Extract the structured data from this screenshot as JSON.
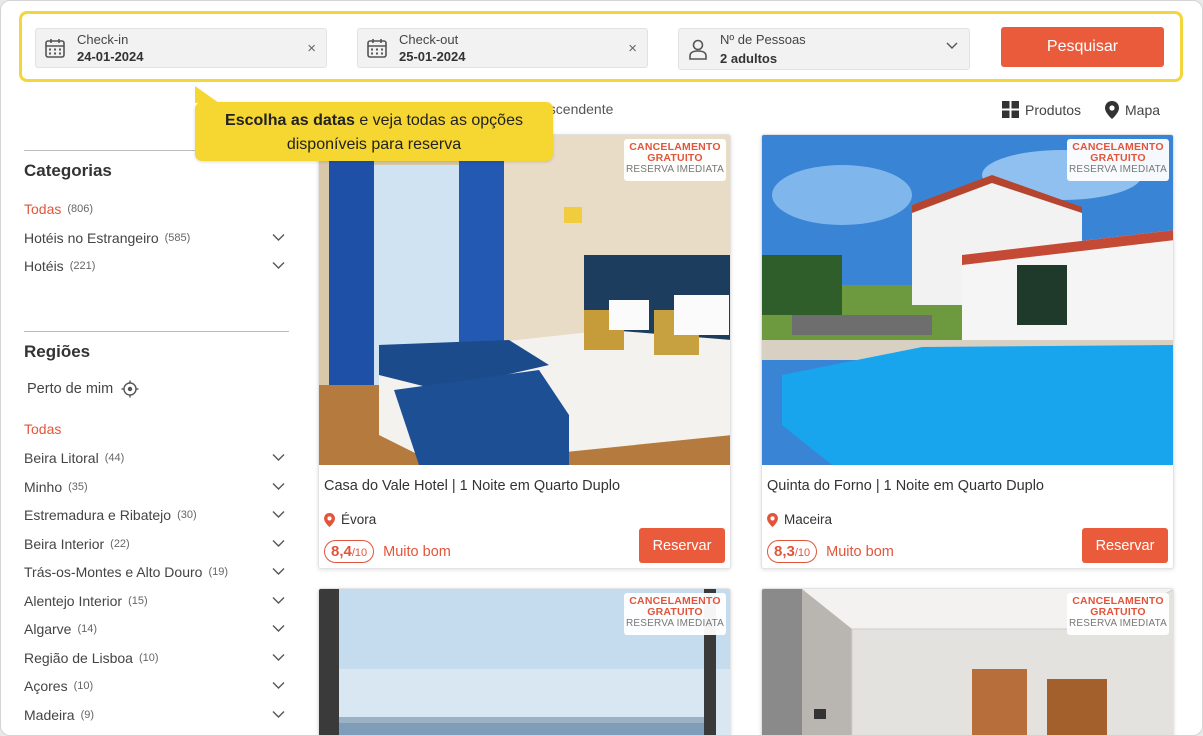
{
  "search": {
    "checkin_label": "Check-in",
    "checkin_value": "24-01-2024",
    "checkout_label": "Check-out",
    "checkout_value": "25-01-2024",
    "people_label": "Nº de Pessoas",
    "people_value": "2 adultos",
    "clear_glyph": "×",
    "search_button": "Pesquisar"
  },
  "tooltip": {
    "bold": "Escolha as datas",
    "text": "e veja todas as opções disponíveis para reserva"
  },
  "toolbar": {
    "sort_partial": "ascendente",
    "products_label": "Produtos",
    "map_label": "Mapa"
  },
  "categories": {
    "title": "Categorias",
    "items": [
      {
        "label": "Todas",
        "count": "(806)"
      },
      {
        "label": "Hotéis no Estrangeiro",
        "count": "(585)"
      },
      {
        "label": "Hotéis",
        "count": "(221)"
      }
    ]
  },
  "regions": {
    "title": "Regiões",
    "near_me": "Perto de mim",
    "all": "Todas",
    "items": [
      {
        "label": "Beira Litoral",
        "count": "(44)"
      },
      {
        "label": "Minho",
        "count": "(35)"
      },
      {
        "label": "Estremadura e Ribatejo",
        "count": "(30)"
      },
      {
        "label": "Beira Interior",
        "count": "(22)"
      },
      {
        "label": "Trás-os-Montes e Alto Douro",
        "count": "(19)"
      },
      {
        "label": "Alentejo Interior",
        "count": "(15)"
      },
      {
        "label": "Algarve",
        "count": "(14)"
      },
      {
        "label": "Região de Lisboa",
        "count": "(10)"
      },
      {
        "label": "Açores",
        "count": "(10)"
      },
      {
        "label": "Madeira",
        "count": "(9)"
      }
    ]
  },
  "badge": {
    "line1": "CANCELAMENTO",
    "line2": "GRATUITO",
    "line3": "RESERVA IMEDIATA"
  },
  "cards": [
    {
      "title": "Casa do Vale Hotel | 1 Noite em Quarto Duplo",
      "location": "Évora",
      "score": "8,4",
      "score_max": "/10",
      "rating_word": "Muito bom",
      "button": "Reservar"
    },
    {
      "title": "Quinta do Forno | 1 Noite em Quarto Duplo",
      "location": "Maceira",
      "score": "8,3",
      "score_max": "/10",
      "rating_word": "Muito bom",
      "button": "Reservar"
    },
    {
      "title": "",
      "location": "",
      "score": "",
      "score_max": "",
      "rating_word": "",
      "button": ""
    },
    {
      "title": "",
      "location": "",
      "score": "",
      "score_max": "",
      "rating_word": "",
      "button": ""
    }
  ],
  "colors": {
    "accent": "#ea5b3c",
    "highlight": "#f3d63b",
    "tooltip": "#f6d631"
  }
}
